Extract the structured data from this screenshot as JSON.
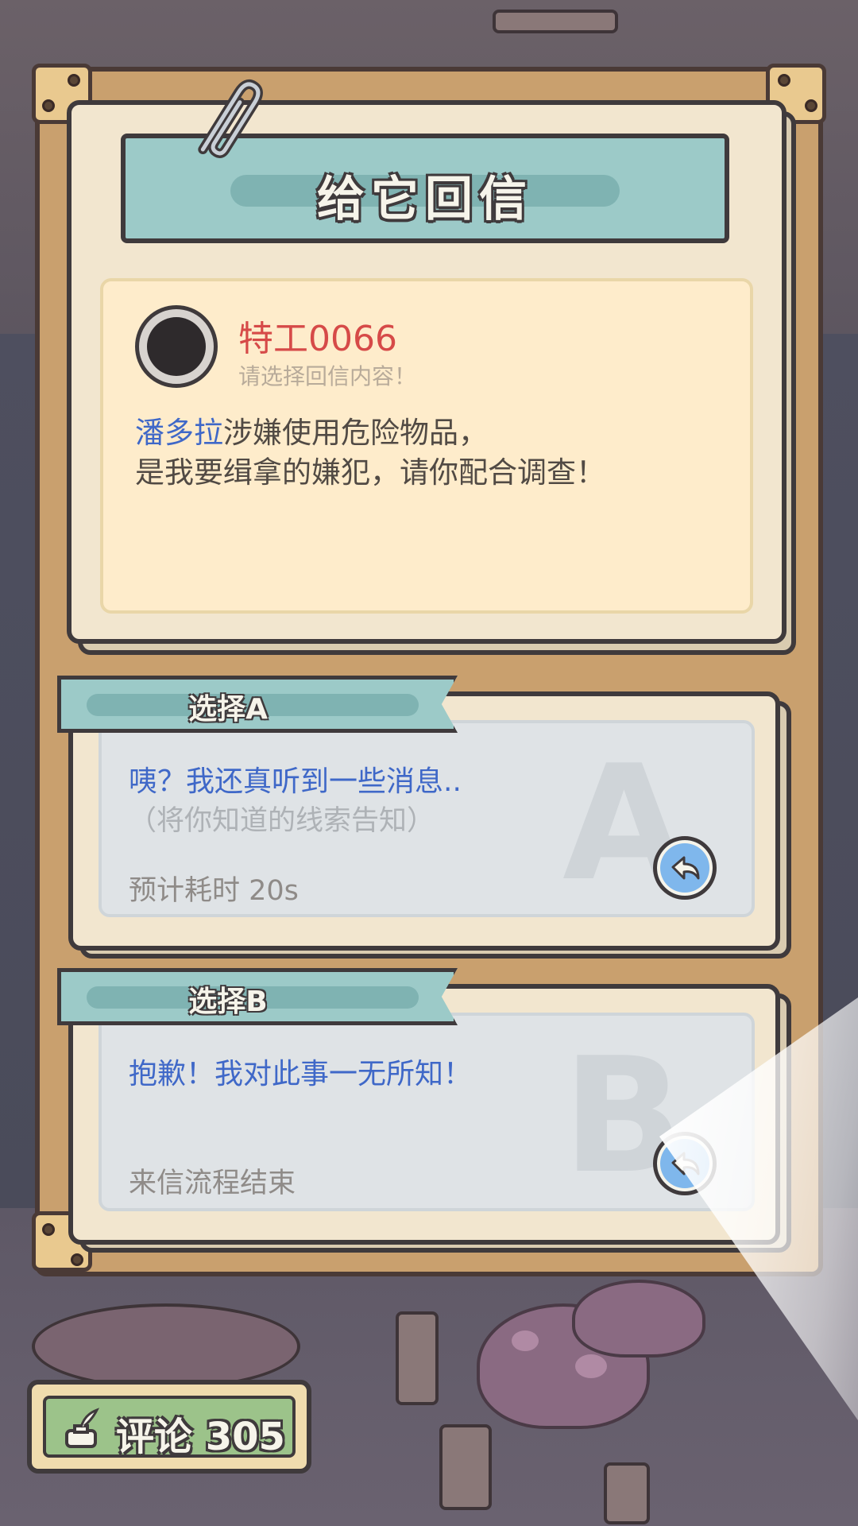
{
  "title": "给它回信",
  "letter": {
    "sender_name": "特工0066",
    "sender_hint": "请选择回信内容！",
    "body_highlight": "潘多拉",
    "body_line1_rest": "涉嫌使用危险物品，",
    "body_line2": "是我要缉拿的嫌犯，请你配合调查！"
  },
  "choices": [
    {
      "tab_label": "选择A",
      "big_letter": "A",
      "text": "咦？我还真听到一些消息..",
      "subtext": "（将你知道的线索告知）",
      "meta": "预计耗时  20s",
      "button_icon": "reply-arrow-icon"
    },
    {
      "tab_label": "选择B",
      "big_letter": "B",
      "text": "抱歉！我对此事一无所知！",
      "subtext": "",
      "meta": "来信流程结束",
      "button_icon": "reply-arrow-icon"
    }
  ],
  "comment": {
    "label": "评论",
    "count": "305",
    "icon": "quill-inkwell-icon"
  },
  "colors": {
    "banner": "#9ccac8",
    "paper": "#f2e6cf",
    "letter_bg": "#feeccb",
    "sender_name": "#d64a48",
    "choice_text": "#3f68c8",
    "comment_bg": "#9cc38a"
  }
}
